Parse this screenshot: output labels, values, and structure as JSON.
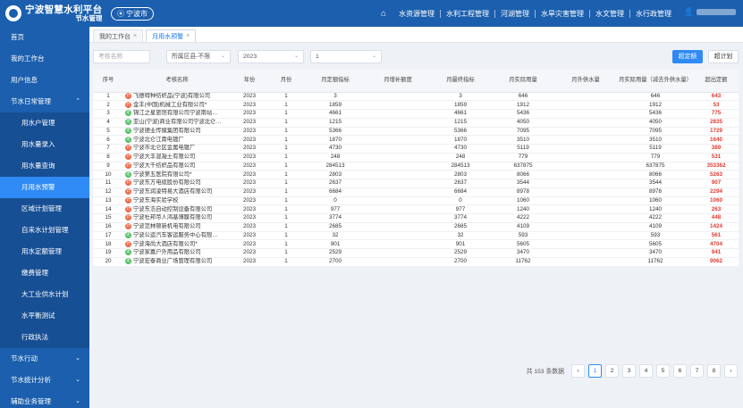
{
  "header": {
    "title": "宁波智慧水利平台",
    "subtitle": "节水管理",
    "city": "宁波市",
    "nav": [
      "水资源管理",
      "水利工程管理",
      "河湖管理",
      "水旱灾害管理",
      "水文管理",
      "水行政管理"
    ]
  },
  "sidebar": {
    "items": [
      {
        "label": "首页",
        "type": "top"
      },
      {
        "label": "我的工作台",
        "type": "top"
      },
      {
        "label": "用户信息",
        "type": "top"
      },
      {
        "label": "节水日常管理",
        "type": "group",
        "chev": "⌃"
      },
      {
        "label": "用水户管理",
        "type": "sub"
      },
      {
        "label": "用水量录入",
        "type": "sub"
      },
      {
        "label": "用水量查询",
        "type": "sub"
      },
      {
        "label": "月用水预警",
        "type": "sub",
        "active": true
      },
      {
        "label": "区域计划管理",
        "type": "sub"
      },
      {
        "label": "自来水计划管理",
        "type": "sub"
      },
      {
        "label": "用水定额管理",
        "type": "sub"
      },
      {
        "label": "缴费管理",
        "type": "sub"
      },
      {
        "label": "大工业供水计划",
        "type": "sub"
      },
      {
        "label": "水平衡测试",
        "type": "sub"
      },
      {
        "label": "行政执法",
        "type": "sub"
      },
      {
        "label": "节水行动",
        "type": "group",
        "chev": "⌄"
      },
      {
        "label": "节水统计分析",
        "type": "group",
        "chev": "⌄"
      },
      {
        "label": "辅助业务管理",
        "type": "group",
        "chev": "⌄"
      }
    ]
  },
  "tabs": [
    {
      "label": "我的工作台",
      "close": "×",
      "active": false
    },
    {
      "label": "月用水预警",
      "close": "×",
      "active": true
    }
  ],
  "filters": {
    "name_placeholder": "考核名称",
    "district": "所属区县-不限",
    "year": "2023",
    "month": "1",
    "caret": "⌄",
    "btn_over": "超定额",
    "btn_plan": "超计划"
  },
  "table": {
    "headers": [
      "序号",
      "考核名称",
      "年份",
      "月份",
      "月定额指标",
      "月增补额度",
      "月最终指标",
      "月实际用量",
      "月外供水量",
      "月实际用量（减去外供水量）",
      "超出定额"
    ],
    "rows": [
      {
        "no": "1",
        "tag": "red",
        "tag_text": "计",
        "name": "飞德特种纺织品(宁波)有限公司",
        "year": "2023",
        "month": "1",
        "quota": "3",
        "extra": "",
        "final": "3",
        "actual": "646",
        "ext": "",
        "net": "646",
        "over": "643"
      },
      {
        "no": "2",
        "tag": "red",
        "tag_text": "计",
        "name": "金丰(中国)机械工业有限公司*",
        "year": "2023",
        "month": "1",
        "quota": "1859",
        "extra": "",
        "final": "1859",
        "actual": "1912",
        "ext": "",
        "net": "1912",
        "over": "53"
      },
      {
        "no": "3",
        "tag": "green",
        "tag_text": "定",
        "name": "锦江之星旅馆有限公司宁波南站…",
        "year": "2023",
        "month": "1",
        "quota": "4661",
        "extra": "",
        "final": "4661",
        "actual": "5436",
        "ext": "",
        "net": "5436",
        "over": "775"
      },
      {
        "no": "4",
        "tag": "green",
        "tag_text": "定",
        "name": "亚山(宁波)商业有限公司宁波北仑…",
        "year": "2023",
        "month": "1",
        "quota": "1215",
        "extra": "",
        "final": "1215",
        "actual": "4050",
        "ext": "",
        "net": "4050",
        "over": "2835"
      },
      {
        "no": "5",
        "tag": "green",
        "tag_text": "定",
        "name": "宁波德业传媒集团有限公司",
        "year": "2023",
        "month": "1",
        "quota": "5366",
        "extra": "",
        "final": "5366",
        "actual": "7095",
        "ext": "",
        "net": "7095",
        "over": "1729"
      },
      {
        "no": "6",
        "tag": "green",
        "tag_text": "定",
        "name": "宁波北仑江南电镀厂",
        "year": "2023",
        "month": "1",
        "quota": "1870",
        "extra": "",
        "final": "1870",
        "actual": "3510",
        "ext": "",
        "net": "3510",
        "over": "1640"
      },
      {
        "no": "7",
        "tag": "red",
        "tag_text": "计",
        "name": "宁波市北仑区金属电镀厂",
        "year": "2023",
        "month": "1",
        "quota": "4730",
        "extra": "",
        "final": "4730",
        "actual": "5119",
        "ext": "",
        "net": "5119",
        "over": "389"
      },
      {
        "no": "8",
        "tag": "red",
        "tag_text": "计",
        "name": "宁波大丰混凝土有限公司",
        "year": "2023",
        "month": "1",
        "quota": "248",
        "extra": "",
        "final": "248",
        "actual": "779",
        "ext": "",
        "net": "779",
        "over": "531"
      },
      {
        "no": "9",
        "tag": "red",
        "tag_text": "计",
        "name": "宁波大千纺织品有限公司",
        "year": "2023",
        "month": "1",
        "quota": "284513",
        "extra": "",
        "final": "284513",
        "actual": "637875",
        "ext": "",
        "net": "637875",
        "over": "353362"
      },
      {
        "no": "10",
        "tag": "green",
        "tag_text": "定",
        "name": "宁波第五医院有限公司*",
        "year": "2023",
        "month": "1",
        "quota": "2803",
        "extra": "",
        "final": "2803",
        "actual": "8066",
        "ext": "",
        "net": "8066",
        "over": "5263"
      },
      {
        "no": "11",
        "tag": "red",
        "tag_text": "计",
        "name": "宁波东方电缆股份有限公司",
        "year": "2023",
        "month": "1",
        "quota": "2637",
        "extra": "",
        "final": "2637",
        "actual": "3544",
        "ext": "",
        "net": "3544",
        "over": "907"
      },
      {
        "no": "12",
        "tag": "red",
        "tag_text": "计",
        "name": "宁波东润凌特易大酒店有限公司",
        "year": "2023",
        "month": "1",
        "quota": "6684",
        "extra": "",
        "final": "6684",
        "actual": "8978",
        "ext": "",
        "net": "8978",
        "over": "2294"
      },
      {
        "no": "13",
        "tag": "red",
        "tag_text": "计",
        "name": "宁波东海实验学校",
        "year": "2023",
        "month": "1",
        "quota": "0",
        "extra": "",
        "final": "0",
        "actual": "1060",
        "ext": "",
        "net": "1060",
        "over": "1060"
      },
      {
        "no": "14",
        "tag": "red",
        "tag_text": "计",
        "name": "宁波东浩自动控制设备有限公司",
        "year": "2023",
        "month": "1",
        "quota": "977",
        "extra": "",
        "final": "977",
        "actual": "1240",
        "ext": "",
        "net": "1240",
        "over": "263"
      },
      {
        "no": "15",
        "tag": "red",
        "tag_text": "计",
        "name": "宁波杜邦帝人鸿基薄膜有限公司",
        "year": "2023",
        "month": "1",
        "quota": "3774",
        "extra": "",
        "final": "3774",
        "actual": "4222",
        "ext": "",
        "net": "4222",
        "over": "448"
      },
      {
        "no": "16",
        "tag": "red",
        "tag_text": "计",
        "name": "宁波范林顿新机电有限公司",
        "year": "2023",
        "month": "1",
        "quota": "2685",
        "extra": "",
        "final": "2685",
        "actual": "4109",
        "ext": "",
        "net": "4109",
        "over": "1424"
      },
      {
        "no": "17",
        "tag": "green",
        "tag_text": "定",
        "name": "宁波公运汽车客运服务中心有限…",
        "year": "2023",
        "month": "1",
        "quota": "32",
        "extra": "",
        "final": "32",
        "actual": "593",
        "ext": "",
        "net": "593",
        "over": "561"
      },
      {
        "no": "18",
        "tag": "red",
        "tag_text": "计",
        "name": "宁波海尚大酒店有限公司*",
        "year": "2023",
        "month": "1",
        "quota": "901",
        "extra": "",
        "final": "901",
        "actual": "5605",
        "ext": "",
        "net": "5605",
        "over": "4704"
      },
      {
        "no": "19",
        "tag": "green",
        "tag_text": "定",
        "name": "宁波家嘉户外用品有限公司",
        "year": "2023",
        "month": "1",
        "quota": "2529",
        "extra": "",
        "final": "2529",
        "actual": "3470",
        "ext": "",
        "net": "3470",
        "over": "941"
      },
      {
        "no": "20",
        "tag": "green",
        "tag_text": "定",
        "name": "宁波宏泰商业广场管理有限公司",
        "year": "2023",
        "month": "1",
        "quota": "2700",
        "extra": "",
        "final": "2700",
        "actual": "11762",
        "ext": "",
        "net": "11762",
        "over": "9062"
      }
    ]
  },
  "pagination": {
    "total": "共 153 条数据",
    "prev": "‹",
    "next": "›",
    "pages": [
      "1",
      "2",
      "3",
      "4",
      "5",
      "6",
      "7",
      "8"
    ],
    "current": "1"
  },
  "icons": {
    "home": "home-icon",
    "user": "user-icon",
    "location": "location-pin-icon"
  },
  "colors": {
    "brand": "#1b5fae",
    "active": "#2f8af5",
    "over": "#e03c31",
    "tag_red": "#e96b4c",
    "tag_green": "#4fbf61"
  }
}
